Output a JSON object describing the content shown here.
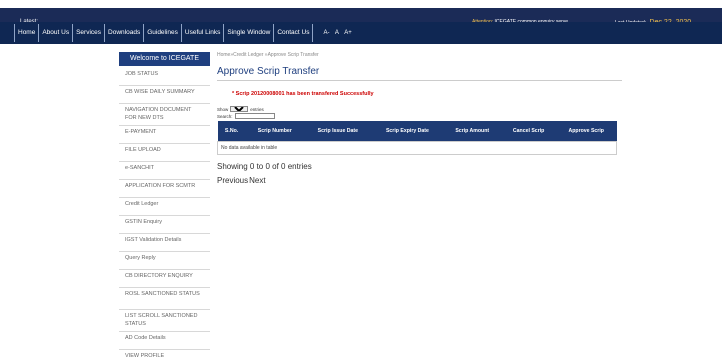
{
  "topbar": {
    "latest_label": "Latest:",
    "ticker_label": "Attention:",
    "ticker_text": "ICEGATE common enquiry serve",
    "last_updated_label": "Last Updated:",
    "last_updated_date": "Dec 22, 2020"
  },
  "nav": {
    "items": [
      "Home",
      "About Us",
      "Services",
      "Downloads",
      "Guidelines",
      "Useful Links",
      "Single Window",
      "Contact Us"
    ],
    "font_controls": [
      "A-",
      "A",
      "A+"
    ]
  },
  "sidebar": {
    "header": "Welcome to ICEGATE",
    "items": [
      "JOB STATUS",
      "CB WISE DAILY SUMMARY",
      "NAVIGATION DOCUMENT FOR NEW DTS",
      "E-PAYMENT",
      "FILE UPLOAD",
      "e-SANCHIT",
      "APPLICATION FOR SCMTR",
      "Credit Ledger",
      "GSTIN Enquiry",
      "IGST Validation Details",
      "Query Reply",
      "CB DIRECTORY ENQUIRY",
      "ROSL SANCTIONED STATUS",
      "LIST SCROLL SANCTIONED STATUS",
      "AD Code Details",
      "VIEW PROFILE"
    ]
  },
  "main": {
    "breadcrumb": "Home»Credit Ledger »Approve Scrip Transfer",
    "title": "Approve Scrip Transfer",
    "success_message": "* Scrip 20120008001 has been transfered Successfully",
    "show_label": "Show",
    "entries_value": "10",
    "entries_label": "entries",
    "search_label": "Search:",
    "table": {
      "headers": [
        "S.No.",
        "Scrip Number",
        "Scrip Issue Date",
        "Scrip Expiry Date",
        "Scrip Amount",
        "Cancel Scrip",
        "Approve Scrip"
      ],
      "empty_message": "No data available in table"
    },
    "info": "Showing 0 to 0 of 0 entries",
    "prev": "Previous",
    "next": "Next"
  }
}
